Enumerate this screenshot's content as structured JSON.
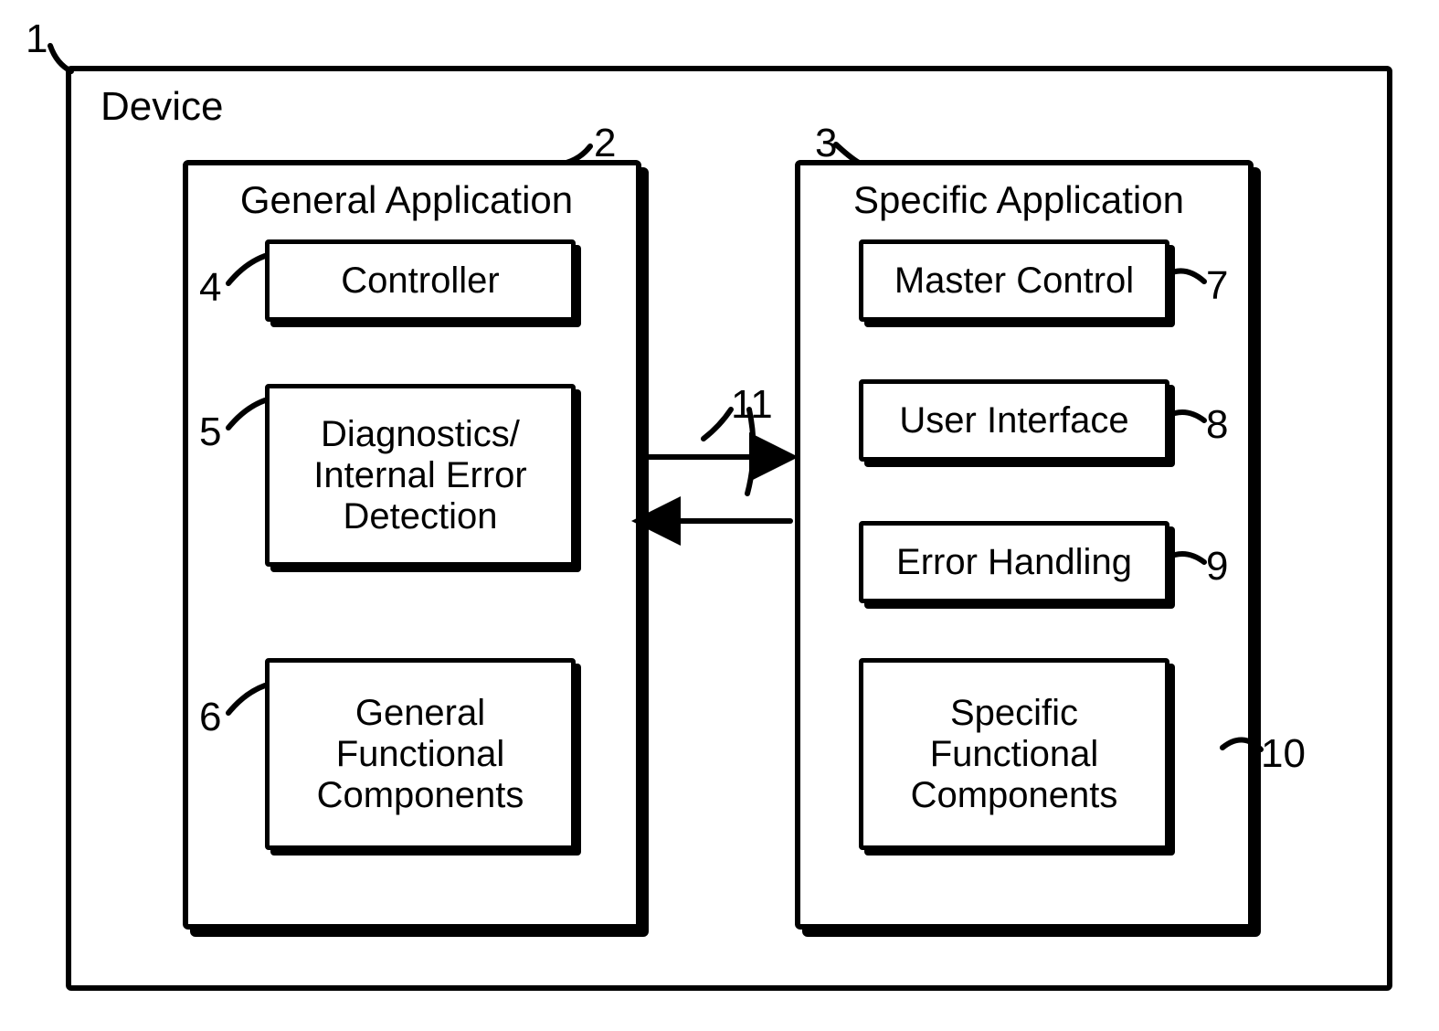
{
  "refs": {
    "r1": "1",
    "r2": "2",
    "r3": "3",
    "r4": "4",
    "r5": "5",
    "r6": "6",
    "r7": "7",
    "r8": "8",
    "r9": "9",
    "r10": "10",
    "r11": "11"
  },
  "outer": {
    "title": "Device"
  },
  "left": {
    "title": "General Application",
    "items": {
      "controller": "Controller",
      "diagnostics": "Diagnostics/\nInternal Error\nDetection",
      "general_components": "General\nFunctional\nComponents"
    }
  },
  "right": {
    "title": "Specific Application",
    "items": {
      "master_control": "Master Control",
      "user_interface": "User Interface",
      "error_handling": "Error Handling",
      "specific_components": "Specific\nFunctional\nComponents"
    }
  }
}
